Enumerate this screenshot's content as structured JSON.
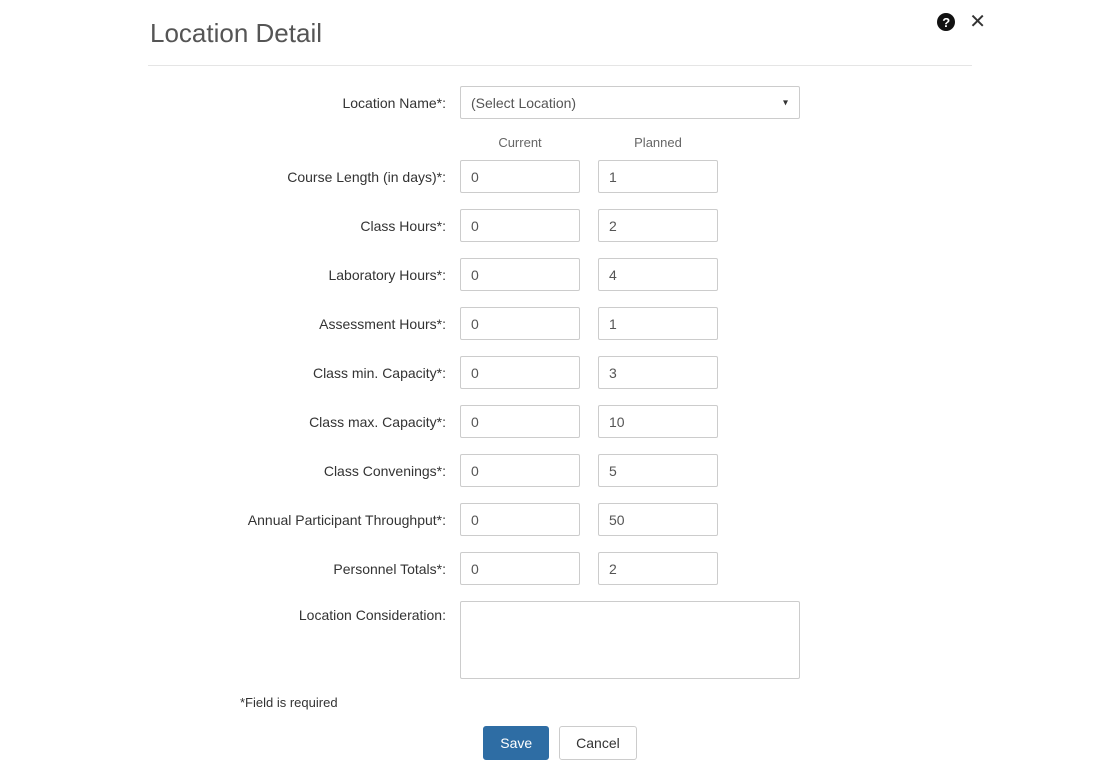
{
  "header": {
    "title": "Location Detail"
  },
  "form": {
    "location_name_label": "Location Name*:",
    "location_name_placeholder": "(Select Location)",
    "columns": {
      "current": "Current",
      "planned": "Planned"
    },
    "rows": {
      "course_length": {
        "label": "Course Length (in days)*:",
        "current": "0",
        "planned": "1"
      },
      "class_hours": {
        "label": "Class Hours*:",
        "current": "0",
        "planned": "2"
      },
      "lab_hours": {
        "label": "Laboratory Hours*:",
        "current": "0",
        "planned": "4"
      },
      "assessment_hours": {
        "label": "Assessment Hours*:",
        "current": "0",
        "planned": "1"
      },
      "class_min_cap": {
        "label": "Class min. Capacity*:",
        "current": "0",
        "planned": "3"
      },
      "class_max_cap": {
        "label": "Class max. Capacity*:",
        "current": "0",
        "planned": "10"
      },
      "class_convenings": {
        "label": "Class Convenings*:",
        "current": "0",
        "planned": "5"
      },
      "annual_throughput": {
        "label": "Annual Participant Throughput*:",
        "current": "0",
        "planned": "50"
      },
      "personnel_totals": {
        "label": "Personnel Totals*:",
        "current": "0",
        "planned": "2"
      }
    },
    "location_consideration_label": "Location Consideration:",
    "location_consideration_value": "",
    "required_note": "*Field is required"
  },
  "buttons": {
    "save": "Save",
    "cancel": "Cancel"
  }
}
